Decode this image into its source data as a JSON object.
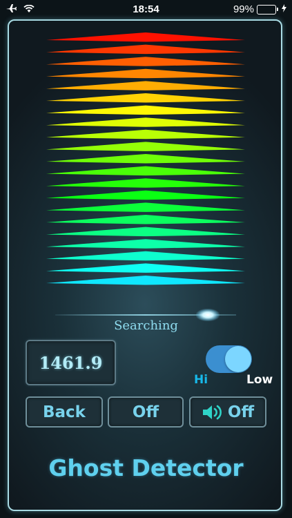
{
  "status_bar": {
    "time": "18:54",
    "battery_text": "99%",
    "battery_level": 0.99,
    "icons": [
      "airplane-icon",
      "wifi-icon",
      "battery-icon",
      "charging-bolt-icon"
    ]
  },
  "meter": {
    "bar_count": 21,
    "colors_top_to_bottom": [
      "#ff1a08",
      "#00e5ff"
    ]
  },
  "scan": {
    "label": "Searching",
    "progress": 0.85
  },
  "readout": {
    "value": "1461.9"
  },
  "sensitivity": {
    "hi_label": "Hi",
    "low_label": "Low",
    "state": "Low"
  },
  "buttons": {
    "back_label": "Back",
    "power_label": "Off",
    "sound_label": "Off",
    "sound_icon": "speaker-icon"
  },
  "app": {
    "title": "Ghost Detector"
  },
  "accent_color": "#5fd0ee"
}
